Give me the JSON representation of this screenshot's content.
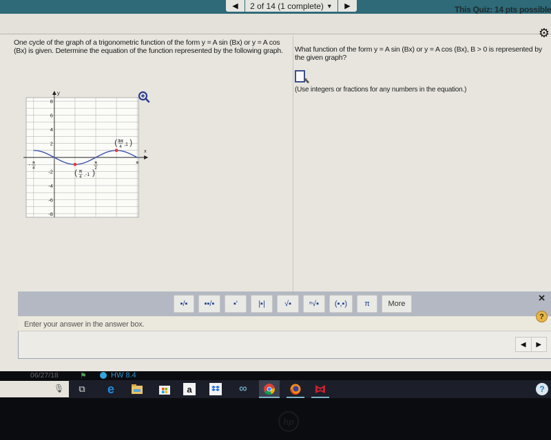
{
  "topbar": {
    "prev_label": "◀",
    "question_selector": "2 of 14 (1 complete)",
    "selector_caret": "▼",
    "next_label": "▶",
    "quiz_points": "This Quiz: 14 pts possible"
  },
  "settings_icon": "⚙",
  "left_panel": {
    "question_text": "One cycle of the graph of a trigonometric function of the form y = A sin (Bx) or y = A cos (Bx) is given. Determine the equation of the function represented by the following graph."
  },
  "right_panel": {
    "question_text": "What function of the form y = A sin (Bx) or y = A cos (Bx), B > 0 is represented by the given graph?",
    "answer_value": "",
    "hint": "(Use integers or fractions for any numbers in the equation.)"
  },
  "graph": {
    "y_label": "y",
    "x_label": "x",
    "y_ticks": [
      "8",
      "6",
      "4",
      "2",
      "-2",
      "-4",
      "-6",
      "-8"
    ],
    "x_tick_labels": [
      {
        "num": "π",
        "den": "4",
        "sign": "-"
      },
      {
        "num": "π",
        "den": "2",
        "sign": ""
      },
      {
        "num": "π",
        "den": "",
        "sign": ""
      }
    ],
    "points": [
      {
        "label_num": "π",
        "label_den": "4",
        "label_y": "-1",
        "x": "π/4",
        "y": -1
      },
      {
        "label_num": "3π",
        "label_den": "4",
        "label_y": "1",
        "x": "3π/4",
        "y": 1
      }
    ],
    "curve_color": "#3a4fa8",
    "point_color": "#e03b3b",
    "zoom_icon": "zoom-in"
  },
  "math_toolbar": {
    "buttons": [
      {
        "name": "fraction",
        "glyph": "▪/▪"
      },
      {
        "name": "mixed-number",
        "glyph": "▪▪/▪"
      },
      {
        "name": "exponent",
        "glyph": "▪'"
      },
      {
        "name": "absolute-value",
        "glyph": "|▪|"
      },
      {
        "name": "square-root",
        "glyph": "√▪"
      },
      {
        "name": "nth-root",
        "glyph": "ⁿ√▪"
      },
      {
        "name": "ordered-pair",
        "glyph": "(▪,▪)"
      },
      {
        "name": "pi",
        "glyph": "π"
      },
      {
        "name": "more",
        "glyph": "More"
      }
    ],
    "close_label": "✕"
  },
  "answer_area": {
    "prompt": "Enter your answer in the answer box.",
    "help_label": "?",
    "pager_prev": "◀",
    "pager_next": "▶"
  },
  "footer": {
    "date": "06/27/18",
    "flag_icon": "⚑",
    "assignment": "HW 8.4"
  },
  "taskbar": {
    "apps": [
      "task-view",
      "edge",
      "file-explorer",
      "store",
      "amazon",
      "dropbox",
      "infinity",
      "chrome",
      "firefox",
      "mcafee"
    ],
    "amazon_glyph": "a",
    "tray_help": "?"
  },
  "brand": "hp"
}
